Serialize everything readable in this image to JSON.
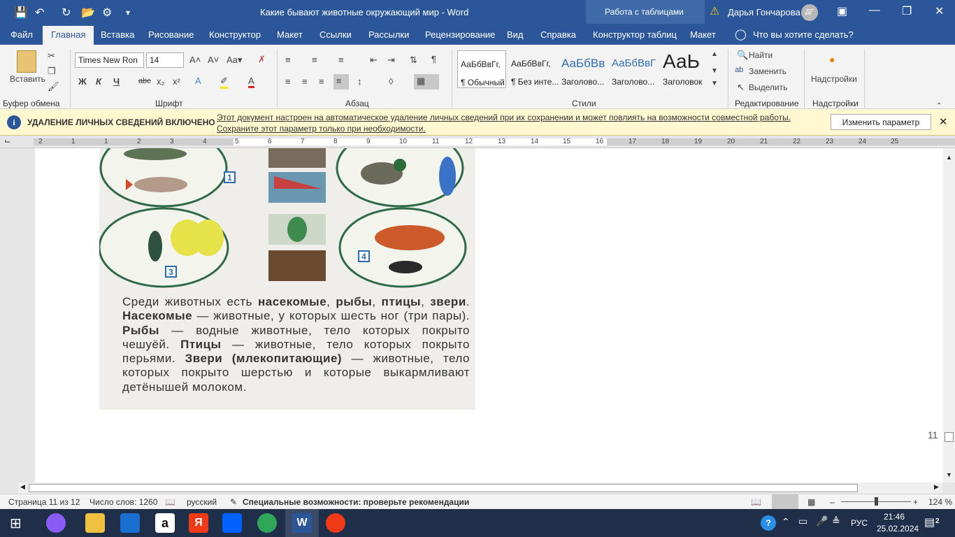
{
  "title_bar": {
    "title": "Какие бывают животные окружающий мир  -  Word",
    "context_tab": "Работа с таблицами",
    "user": "Дарья Гончарова",
    "avatar": "ДГ"
  },
  "tabs": [
    "Файл",
    "Главная",
    "Вставка",
    "Рисование",
    "Конструктор",
    "Макет",
    "Ссылки",
    "Рассылки",
    "Рецензирование",
    "Вид",
    "Справка",
    "Конструктор таблиц",
    "Макет"
  ],
  "tell_me": "Что вы хотите сделать?",
  "ribbon": {
    "clipboard": {
      "paste": "Вставить",
      "group": "Буфер обмена"
    },
    "font": {
      "name": "Times New Ron",
      "size": "14",
      "group": "Шрифт",
      "bold": "Ж",
      "italic": "К",
      "underline": "Ч",
      "strike": "abc"
    },
    "paragraph": {
      "group": "Абзац"
    },
    "styles": {
      "group": "Стили",
      "items": [
        {
          "sample": "АаБбВвГг,",
          "name": "¶ Обычный"
        },
        {
          "sample": "АаБбВвГг,",
          "name": "¶ Без инте..."
        },
        {
          "sample": "АаБбВв",
          "name": "Заголово..."
        },
        {
          "sample": "АаБбВвГ",
          "name": "Заголово..."
        },
        {
          "sample": "АаЬ",
          "name": "Заголовок"
        }
      ]
    },
    "editing": {
      "find": "Найти",
      "replace": "Заменить",
      "select": "Выделить",
      "group": "Редактирование"
    },
    "addins": {
      "label": "Надстройки",
      "group": "Надстройки"
    }
  },
  "privacy_bar": {
    "title": "УДАЛЕНИЕ ЛИЧНЫХ СВЕДЕНИЙ ВКЛЮЧЕНО",
    "line1": "Этот документ настроен на автоматическое удаление личных сведений при их сохранении и может повлиять на возможности совместной работы.",
    "line2": "Сохраните этот параметр только при необходимости.",
    "button": "Изменить параметр"
  },
  "ruler_numbers": [
    "2",
    "1",
    "1",
    "2",
    "3",
    "4",
    "5",
    "6",
    "7",
    "8",
    "9",
    "10",
    "11",
    "12",
    "13",
    "14",
    "15",
    "16",
    "17",
    "18",
    "19",
    "20",
    "21",
    "22",
    "23",
    "24",
    "25"
  ],
  "document": {
    "text_html": "Среди животных есть <b>насекомые</b>, <b>рыбы</b>, <b>птицы</b>, <b>звери</b>. <b>Насекомые</b> — животные, у которых шесть ног (три пары). <b>Рыбы</b> — водные животные, тело которых покрыто чешуёй. <b>Птицы</b> — животные, тело которых покрыто перьями. <b>Звери (млекопитающие)</b> — животные, тело которых покрыто шерстью и которые выкармливают детёнышей молоком.",
    "group_numbers": [
      "1",
      "3",
      "4"
    ],
    "page_number": "11"
  },
  "status": {
    "page": "Страница 11 из 12",
    "words": "Число слов: 1260",
    "lang": "русский",
    "accessibility": "Специальные возможности: проверьте рекомендации",
    "zoom": "124 %"
  },
  "taskbar": {
    "lang": "РУС",
    "time": "21:46",
    "date": "25.02.2024",
    "notif": "2"
  }
}
